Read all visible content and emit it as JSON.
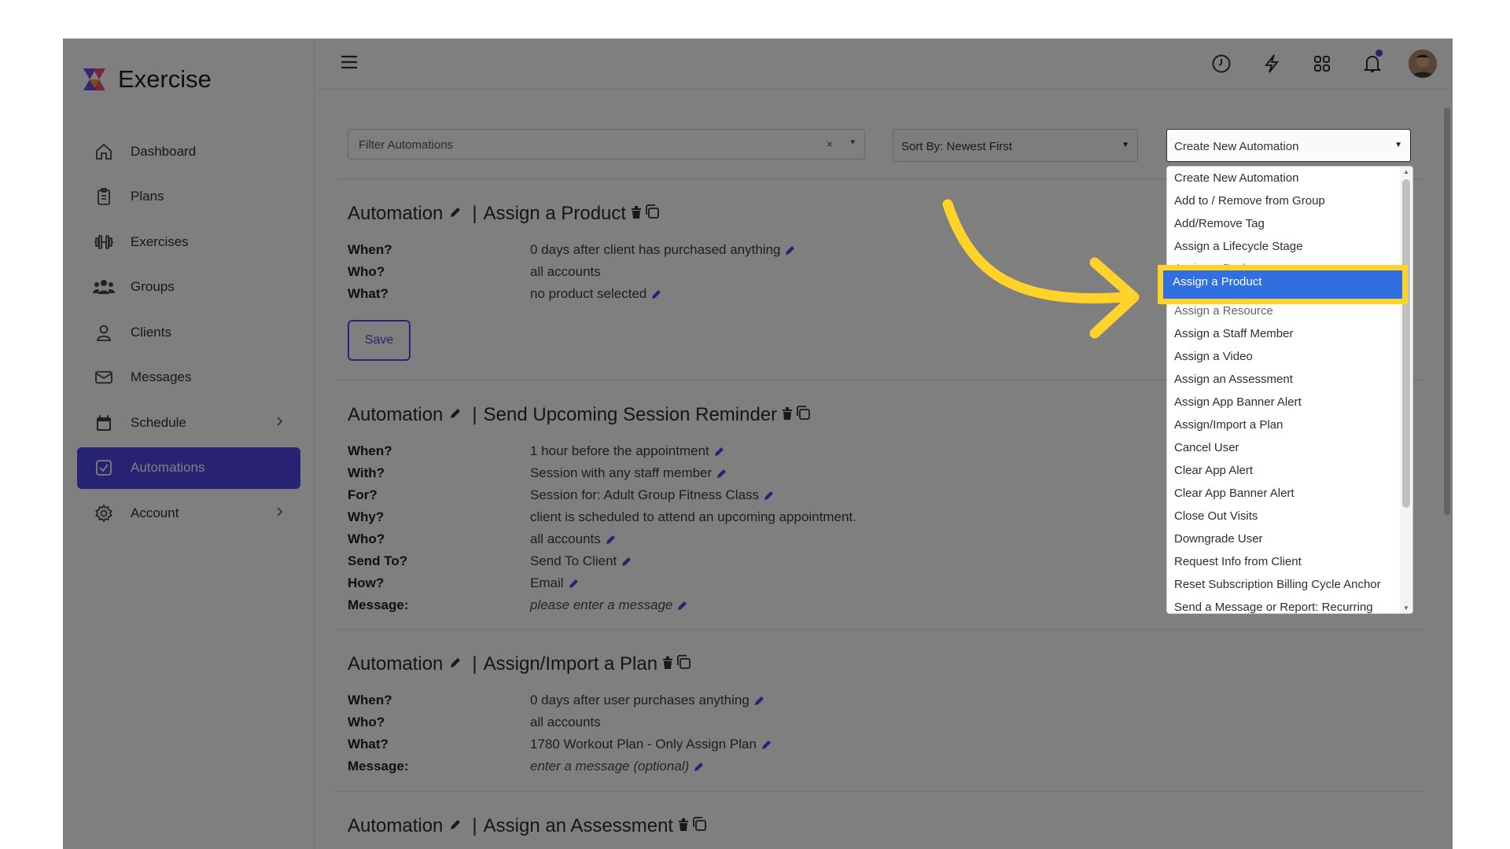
{
  "app": {
    "name": "Exercise"
  },
  "sidebar": {
    "items": [
      {
        "label": "Dashboard",
        "icon": "home-icon"
      },
      {
        "label": "Plans",
        "icon": "clipboard-icon"
      },
      {
        "label": "Exercises",
        "icon": "dumbbell-icon"
      },
      {
        "label": "Groups",
        "icon": "users-icon"
      },
      {
        "label": "Clients",
        "icon": "user-icon"
      },
      {
        "label": "Messages",
        "icon": "mail-icon"
      },
      {
        "label": "Schedule",
        "icon": "calendar-icon"
      },
      {
        "label": "Automations",
        "icon": "checkbox-icon",
        "active": true
      },
      {
        "label": "Account",
        "icon": "gear-icon"
      }
    ]
  },
  "filters": {
    "filter_placeholder": "Filter Automations",
    "clear_symbol": "×",
    "sort_label": "Sort By: Newest First",
    "create_label": "Create New Automation"
  },
  "automations": [
    {
      "prefix": "Automation",
      "sep": "|",
      "name": "Assign a Product",
      "rows": [
        {
          "label": "When?",
          "value": "0 days after client has purchased anything",
          "editable": true
        },
        {
          "label": "Who?",
          "value": "all accounts",
          "editable": false
        },
        {
          "label": "What?",
          "value": "no product selected",
          "editable": true
        }
      ],
      "save_label": "Save"
    },
    {
      "prefix": "Automation",
      "sep": "|",
      "name": "Send Upcoming Session Reminder",
      "rows": [
        {
          "label": "When?",
          "value": "1 hour before the appointment"
        },
        {
          "label": "With?",
          "value": "Session with any staff member"
        },
        {
          "label": "For?",
          "value": "Session for: Adult Group Fitness Class"
        },
        {
          "label": "Why?",
          "value": "client is scheduled to attend an upcoming appointment."
        },
        {
          "label": "Who?",
          "value": "all accounts"
        },
        {
          "label": "Send To?",
          "value": "Send To Client"
        },
        {
          "label": "How?",
          "value": "Email"
        },
        {
          "label": "Message:",
          "value": "please enter a message"
        }
      ]
    },
    {
      "prefix": "Automation",
      "sep": "|",
      "name": "Assign/Import a Plan",
      "rows": [
        {
          "label": "When?",
          "value": "0 days after user purchases anything"
        },
        {
          "label": "Who?",
          "value": "all accounts"
        },
        {
          "label": "What?",
          "value": "1780 Workout Plan - Only Assign Plan"
        },
        {
          "label": "Message:",
          "value": "enter a message (optional)"
        }
      ]
    },
    {
      "prefix": "Automation",
      "sep": "|",
      "name": "Assign an Assessment"
    }
  ],
  "dropdown": {
    "items": [
      "Create New Automation",
      "Add to / Remove from Group",
      "Add/Remove Tag",
      "Assign a Lifecycle Stage",
      "Assign a Package",
      "Assign a Product",
      "Assign a Resource",
      "Assign a Staff Member",
      "Assign a Video",
      "Assign an Assessment",
      "Assign App Banner Alert",
      "Assign/Import a Plan",
      "Cancel User",
      "Clear App Alert",
      "Clear App Banner Alert",
      "Close Out Visits",
      "Downgrade User",
      "Request Info from Client",
      "Reset Subscription Billing Cycle Anchor",
      "Send a Message or Report: Recurring"
    ],
    "highlighted": "Assign a Product"
  },
  "colors": {
    "accent": "#4f46e5",
    "highlight": "#2f6fe0",
    "callout": "#ffd32a"
  }
}
